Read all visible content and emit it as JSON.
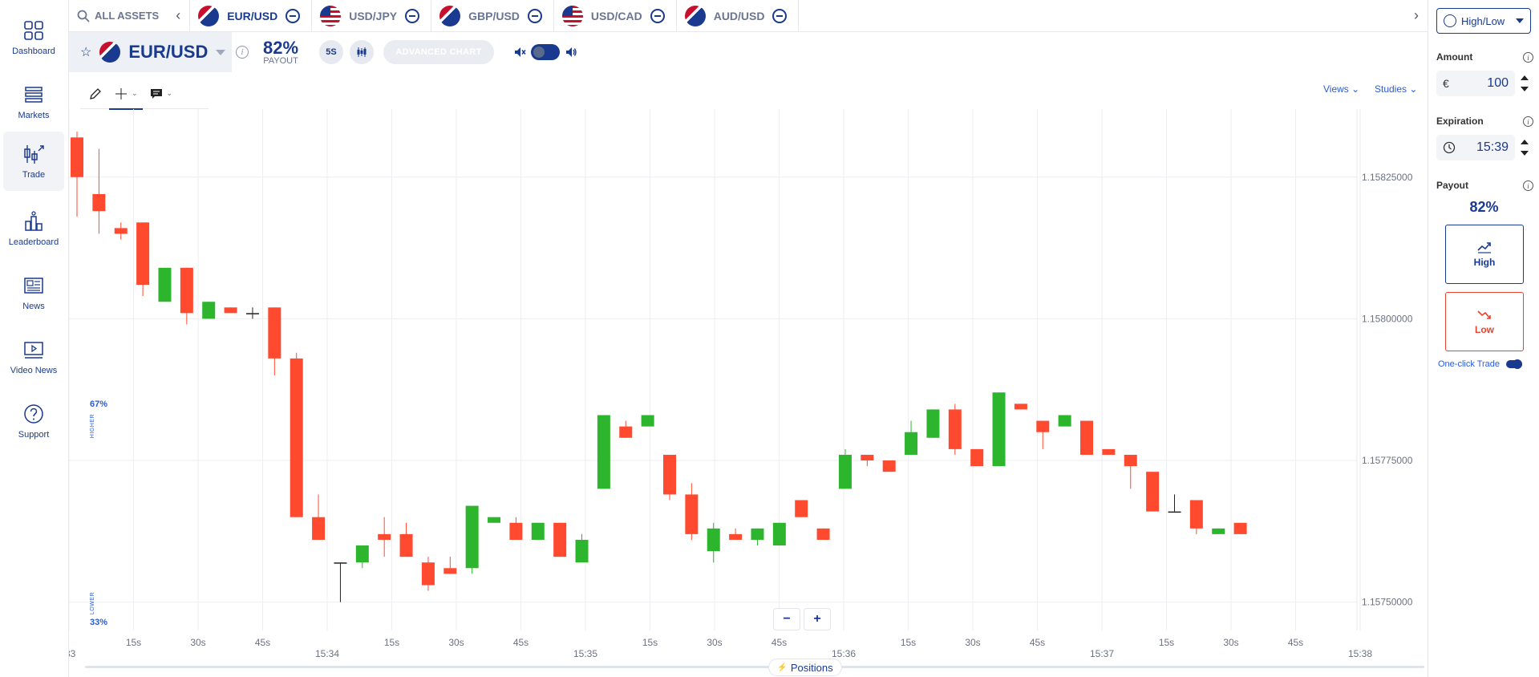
{
  "nav": {
    "items": [
      {
        "label": "Dashboard",
        "icon": "dashboard-icon"
      },
      {
        "label": "Markets",
        "icon": "markets-icon"
      },
      {
        "label": "Trade",
        "icon": "trade-icon"
      },
      {
        "label": "Leaderboard",
        "icon": "leaderboard-icon"
      },
      {
        "label": "News",
        "icon": "news-icon"
      },
      {
        "label": "Video News",
        "icon": "video-news-icon"
      },
      {
        "label": "Support",
        "icon": "support-icon"
      }
    ],
    "active": "Trade"
  },
  "topbar": {
    "all_assets": "ALL ASSETS",
    "tabs": [
      {
        "label": "EUR/USD",
        "active": true
      },
      {
        "label": "USD/JPY",
        "active": false
      },
      {
        "label": "GBP/USD",
        "active": false
      },
      {
        "label": "USD/CAD",
        "active": false
      },
      {
        "label": "AUD/USD",
        "active": false
      }
    ]
  },
  "asset": {
    "name": "EUR/USD",
    "payout": "82%",
    "payout_label": "PAYOUT",
    "interval": "5S",
    "advanced_chart": "ADVANCED CHART"
  },
  "toolbar": {
    "views": "Views",
    "studies": "Studies"
  },
  "sentiment": {
    "higher_pct": "67%",
    "higher_label": "HIGHER",
    "lower_pct": "33%",
    "lower_label": "LOWER"
  },
  "chart_data": {
    "type": "candlestick",
    "y_ticks": [
      "1.15825000",
      "1.15800000",
      "1.15775000",
      "1.15750000"
    ],
    "ylim": [
      1.15745,
      1.15837
    ],
    "x_ticks": [
      {
        "label": ":33",
        "major": true
      },
      {
        "label": "15s",
        "major": false
      },
      {
        "label": "30s",
        "major": false
      },
      {
        "label": "45s",
        "major": false
      },
      {
        "label": "15:34",
        "major": true
      },
      {
        "label": "15s",
        "major": false
      },
      {
        "label": "30s",
        "major": false
      },
      {
        "label": "45s",
        "major": false
      },
      {
        "label": "15:35",
        "major": true
      },
      {
        "label": "15s",
        "major": false
      },
      {
        "label": "30s",
        "major": false
      },
      {
        "label": "45s",
        "major": false
      },
      {
        "label": "15:36",
        "major": true
      },
      {
        "label": "15s",
        "major": false
      },
      {
        "label": "30s",
        "major": false
      },
      {
        "label": "45s",
        "major": false
      },
      {
        "label": "15:37",
        "major": true
      },
      {
        "label": "15s",
        "major": false
      },
      {
        "label": "30s",
        "major": false
      },
      {
        "label": "45s",
        "major": false
      },
      {
        "label": "15:38",
        "major": true
      }
    ],
    "x_interval_seconds": 5,
    "candles": [
      [
        1.15832,
        1.15833,
        1.15818,
        1.15825
      ],
      [
        1.15822,
        1.1583,
        1.15815,
        1.15819
      ],
      [
        1.15816,
        1.15817,
        1.15814,
        1.15815
      ],
      [
        1.15817,
        1.15817,
        1.15804,
        1.15806
      ],
      [
        1.15803,
        1.15809,
        1.15803,
        1.15809
      ],
      [
        1.15809,
        1.15809,
        1.15799,
        1.15801
      ],
      [
        1.158,
        1.15803,
        1.158,
        1.15803
      ],
      [
        1.15802,
        1.15802,
        1.15801,
        1.15801
      ],
      [
        1.15801,
        1.15802,
        1.158,
        1.15801
      ],
      [
        1.15802,
        1.15802,
        1.1579,
        1.15793
      ],
      [
        1.15793,
        1.15794,
        1.15765,
        1.15765
      ],
      [
        1.15765,
        1.15769,
        1.15761,
        1.15761
      ],
      [
        1.15757,
        1.15757,
        1.1575,
        1.15757
      ],
      [
        1.15757,
        1.1576,
        1.15756,
        1.1576
      ],
      [
        1.15762,
        1.15765,
        1.15758,
        1.15761
      ],
      [
        1.15762,
        1.15764,
        1.15758,
        1.15758
      ],
      [
        1.15757,
        1.15758,
        1.15752,
        1.15753
      ],
      [
        1.15756,
        1.15758,
        1.15755,
        1.15755
      ],
      [
        1.15756,
        1.15767,
        1.15755,
        1.15767
      ],
      [
        1.15764,
        1.15765,
        1.15764,
        1.15765
      ],
      [
        1.15764,
        1.15765,
        1.15761,
        1.15761
      ],
      [
        1.15761,
        1.15764,
        1.15761,
        1.15764
      ],
      [
        1.15764,
        1.15764,
        1.15758,
        1.15758
      ],
      [
        1.15757,
        1.15762,
        1.15757,
        1.15761
      ],
      [
        1.1577,
        1.15783,
        1.1577,
        1.15783
      ],
      [
        1.15781,
        1.15782,
        1.15779,
        1.15779
      ],
      [
        1.15781,
        1.15783,
        1.15781,
        1.15783
      ],
      [
        1.15776,
        1.15776,
        1.15768,
        1.15769
      ],
      [
        1.15769,
        1.15771,
        1.15761,
        1.15762
      ],
      [
        1.15759,
        1.15764,
        1.15757,
        1.15763
      ],
      [
        1.15762,
        1.15763,
        1.15761,
        1.15761
      ],
      [
        1.15761,
        1.15763,
        1.1576,
        1.15763
      ],
      [
        1.1576,
        1.15764,
        1.1576,
        1.15764
      ],
      [
        1.15768,
        1.15768,
        1.15765,
        1.15765
      ],
      [
        1.15763,
        1.15763,
        1.15761,
        1.15761
      ],
      [
        1.1577,
        1.15777,
        1.1577,
        1.15776
      ],
      [
        1.15776,
        1.15776,
        1.15774,
        1.15775
      ],
      [
        1.15775,
        1.15775,
        1.15773,
        1.15773
      ],
      [
        1.15776,
        1.15782,
        1.15776,
        1.1578
      ],
      [
        1.15779,
        1.15784,
        1.15779,
        1.15784
      ],
      [
        1.15784,
        1.15785,
        1.15776,
        1.15777
      ],
      [
        1.15777,
        1.15777,
        1.15774,
        1.15774
      ],
      [
        1.15774,
        1.15787,
        1.15774,
        1.15787
      ],
      [
        1.15785,
        1.15785,
        1.15784,
        1.15784
      ],
      [
        1.15782,
        1.15782,
        1.15777,
        1.1578
      ],
      [
        1.15781,
        1.15782,
        1.15781,
        1.15783
      ],
      [
        1.15782,
        1.15782,
        1.15776,
        1.15776
      ],
      [
        1.15777,
        1.15777,
        1.15776,
        1.15776
      ],
      [
        1.15776,
        1.15776,
        1.1577,
        1.15774
      ],
      [
        1.15773,
        1.15773,
        1.15766,
        1.15766
      ],
      [
        1.15766,
        1.15769,
        1.15766,
        1.15766
      ],
      [
        1.15768,
        1.15768,
        1.15762,
        1.15763
      ],
      [
        1.15762,
        1.15763,
        1.15762,
        1.15763
      ],
      [
        1.15764,
        1.15764,
        1.15762,
        1.15762
      ]
    ]
  },
  "controls": {
    "zoom_out": "−",
    "zoom_in": "+",
    "positions": "Positions"
  },
  "trade_panel": {
    "mode": "High/Low",
    "amount_label": "Amount",
    "currency": "€",
    "amount": "100",
    "expiration_label": "Expiration",
    "expiration": "15:39",
    "payout_label": "Payout",
    "payout": "82%",
    "high_label": "High",
    "low_label": "Low",
    "one_click": "One-click Trade"
  },
  "colors": {
    "up": "#2db52d",
    "down": "#ff4a30",
    "accent": "#1a3a8f",
    "link": "#2a5bd7"
  }
}
